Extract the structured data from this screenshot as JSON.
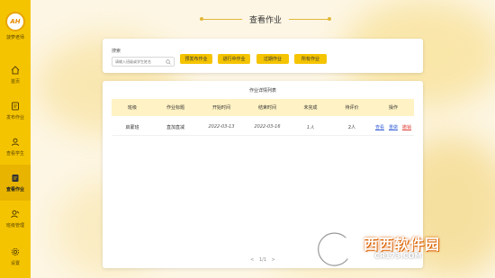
{
  "sidebar": {
    "logo_text": "AH",
    "logo_caption": "菠萝老师",
    "items": [
      {
        "label": "首页",
        "icon": "home-icon"
      },
      {
        "label": "发布作业",
        "icon": "publish-icon"
      },
      {
        "label": "查看学生",
        "icon": "student-icon"
      },
      {
        "label": "查看作业",
        "icon": "homework-icon",
        "active": true
      },
      {
        "label": "班级管理",
        "icon": "class-icon"
      },
      {
        "label": "设置",
        "icon": "gear-icon"
      }
    ]
  },
  "header": {
    "title": "查看作业"
  },
  "search": {
    "label": "搜索",
    "placeholder": "请输入班级或学生姓名",
    "filters": [
      "预发布作业",
      "进行中作业",
      "过期作业",
      "所有作业"
    ]
  },
  "table": {
    "title": "作业详情列表",
    "columns": [
      "班级",
      "作业标题",
      "开始时间",
      "结束时间",
      "未完成",
      "待评价",
      "操作"
    ],
    "rows": [
      {
        "class": "启蒙班",
        "title": "直加直减",
        "start": "2022-03-13",
        "end": "2022-03-16",
        "unfinished": "1人",
        "pending": "2人",
        "actions": [
          "查看",
          "重做",
          "撤销"
        ]
      }
    ]
  },
  "pager": {
    "prev": "<",
    "text": "1/1",
    "next": ">"
  },
  "watermark": {
    "brand": "西西软件园",
    "url": "CR173.COM"
  },
  "colors": {
    "accent": "#f5c400",
    "link": "#3b63d9",
    "danger": "#e0483f"
  }
}
